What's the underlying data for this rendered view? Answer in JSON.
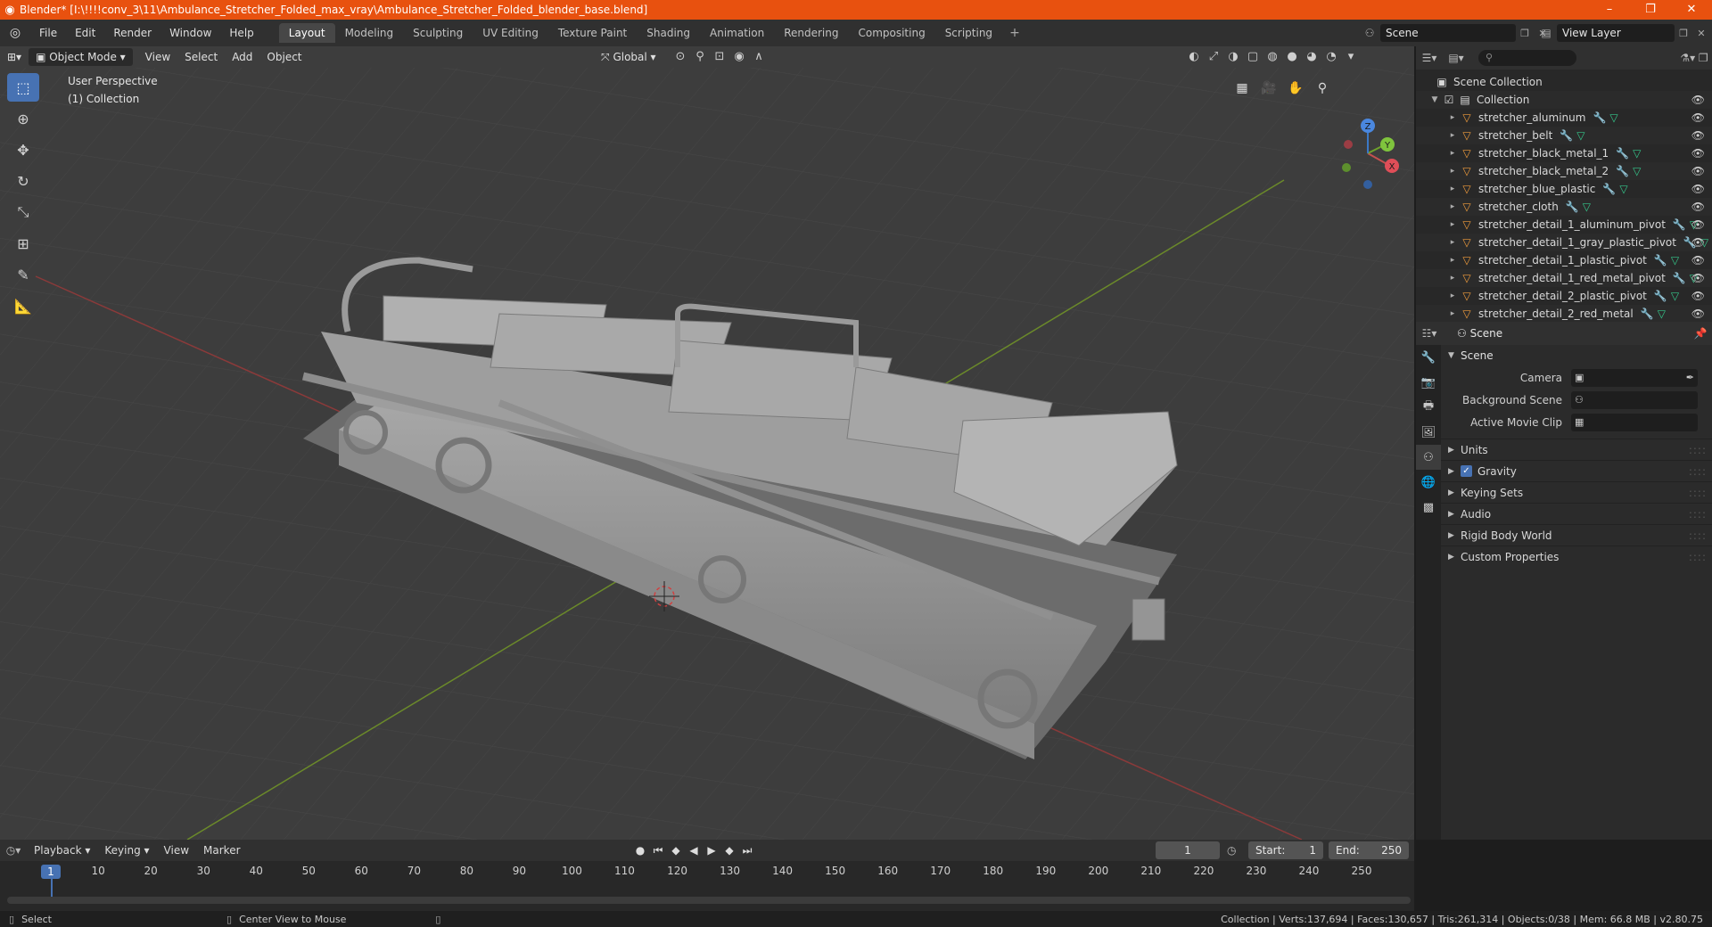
{
  "window": {
    "title": "Blender* [I:\\!!!!conv_3\\11\\Ambulance_Stretcher_Folded_max_vray\\Ambulance_Stretcher_Folded_blender_base.blend]",
    "controls": [
      "–",
      "❐",
      "✕"
    ]
  },
  "menu": [
    "File",
    "Edit",
    "Render",
    "Window",
    "Help"
  ],
  "workspaces": [
    "Layout",
    "Modeling",
    "Sculpting",
    "UV Editing",
    "Texture Paint",
    "Shading",
    "Animation",
    "Rendering",
    "Compositing",
    "Scripting"
  ],
  "active_workspace": "Layout",
  "scene_selector": "Scene",
  "view_layer_selector": "View Layer",
  "viewport": {
    "mode": "Object Mode",
    "menus": [
      "View",
      "Select",
      "Add",
      "Object"
    ],
    "orientation": "Global",
    "overlay_line1": "User Perspective",
    "overlay_line2": "(1) Collection",
    "gizmo": {
      "x": "X",
      "y": "Y",
      "z": "Z"
    }
  },
  "outliner": {
    "root": "Scene Collection",
    "collection": "Collection",
    "objects": [
      "stretcher_aluminum",
      "stretcher_belt",
      "stretcher_black_metal_1",
      "stretcher_black_metal_2",
      "stretcher_blue_plastic",
      "stretcher_cloth",
      "stretcher_detail_1_aluminum_pivot",
      "stretcher_detail_1_gray_plastic_pivot",
      "stretcher_detail_1_plastic_pivot",
      "stretcher_detail_1_red_metal_pivot",
      "stretcher_detail_2_plastic_pivot",
      "stretcher_detail_2_red_metal"
    ]
  },
  "properties": {
    "header": "Scene",
    "panel_title": "Scene",
    "fields": [
      {
        "label": "Camera",
        "value": ""
      },
      {
        "label": "Background Scene",
        "value": ""
      },
      {
        "label": "Active Movie Clip",
        "value": ""
      }
    ],
    "sections": [
      "Units",
      "Gravity",
      "Keying Sets",
      "Audio",
      "Rigid Body World",
      "Custom Properties"
    ],
    "gravity_checked": true
  },
  "timeline": {
    "menus": [
      "Playback",
      "Keying",
      "View",
      "Marker"
    ],
    "current_frame": "1",
    "start_label": "Start:",
    "start": "1",
    "end_label": "End:",
    "end": "250",
    "ruler": [
      1,
      10,
      20,
      30,
      40,
      50,
      60,
      70,
      80,
      90,
      100,
      110,
      120,
      130,
      140,
      150,
      160,
      170,
      180,
      190,
      200,
      210,
      220,
      230,
      240,
      250
    ]
  },
  "statusbar": {
    "left_action": "Select",
    "middle_action": "Center View to Mouse",
    "stats": "Collection | Verts:137,694 | Faces:130,657 | Tris:261,314 | Objects:0/38 | Mem: 66.8 MB | v2.80.75"
  }
}
